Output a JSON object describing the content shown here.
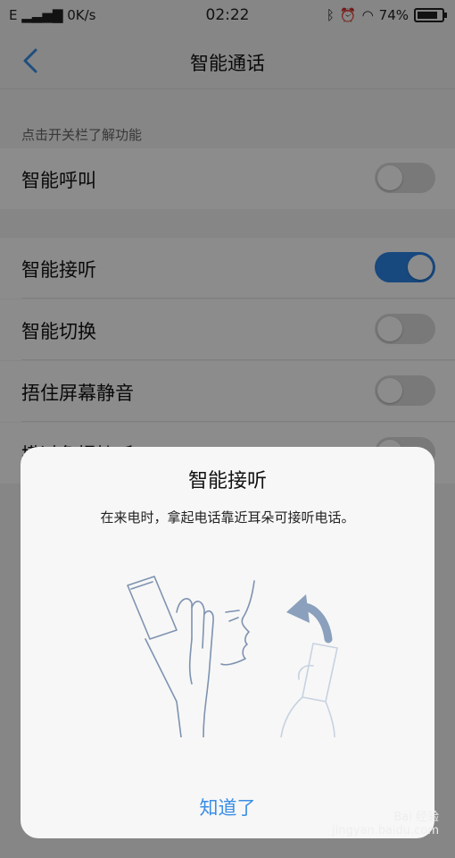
{
  "status_bar": {
    "carrier": "E",
    "speed": "0K/s",
    "time": "02:22",
    "battery": "74%"
  },
  "nav": {
    "title": "智能通话"
  },
  "section_hint": "点击开关栏了解功能",
  "rows": [
    {
      "label": "智能呼叫",
      "on": false
    },
    {
      "label": "智能接听",
      "on": true
    },
    {
      "label": "智能切换",
      "on": false
    },
    {
      "label": "捂住屏幕静音",
      "on": false
    },
    {
      "label": "摸过免提接听",
      "on": false
    }
  ],
  "dialog": {
    "title": "智能接听",
    "body": "在来电时，拿起电话靠近耳朵可接听电话。",
    "confirm": "知道了"
  },
  "watermark": {
    "brand": "Bai 经验",
    "url": "jingyan.baidu.com"
  },
  "colors": {
    "accent": "#2b84e6",
    "button_text": "#3a8ee6"
  }
}
